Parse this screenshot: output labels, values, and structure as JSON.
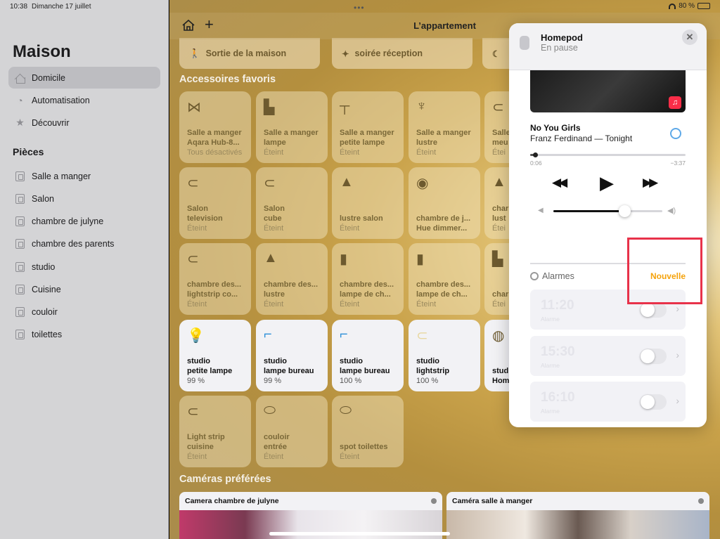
{
  "status": {
    "time": "10:38",
    "date": "Dimanche 17 juillet",
    "battery": "80 %",
    "battery_fraction": 0.8
  },
  "sidebar": {
    "title": "Maison",
    "nav": [
      {
        "label": "Domicile",
        "icon": "house-icon"
      },
      {
        "label": "Automatisation",
        "icon": "clock-icon"
      },
      {
        "label": "Découvrir",
        "icon": "star-icon"
      }
    ],
    "rooms_title": "Pièces",
    "rooms": [
      "Salle a manger",
      "Salon",
      "chambre de julyne",
      "chambre des parents",
      "studio",
      "Cuisine",
      "couloir",
      "toilettes"
    ]
  },
  "nav": {
    "title": "L’appartement",
    "add": "+"
  },
  "scenes": [
    {
      "label": "Sortie de la maison",
      "icon": "walking-person-icon"
    },
    {
      "label": "soirée réception",
      "icon": "party-popper-icon"
    },
    {
      "label": "",
      "icon": "moon-house-icon"
    }
  ],
  "favorites_title": "Accessoires favoris",
  "tiles": [
    {
      "l1": "Salle a manger",
      "l2": "Aqara Hub-8...",
      "st": "Tous désactivés",
      "icon": "hub-icon",
      "on": false
    },
    {
      "l1": "Salle a manger",
      "l2": "lampe",
      "st": "Éteint",
      "icon": "table-lamp-icon",
      "on": false
    },
    {
      "l1": "Salle a manger",
      "l2": "petite lampe",
      "st": "Éteint",
      "icon": "floor-lamp-icon",
      "on": false
    },
    {
      "l1": "Salle a manger",
      "l2": "lustre",
      "st": "Éteint",
      "icon": "chandelier-icon",
      "on": false
    },
    {
      "l1": "Salle",
      "l2": "meu",
      "st": "Étei",
      "icon": "lightstrip-icon",
      "on": false
    },
    {
      "l1": "Salon",
      "l2": "television",
      "st": "Éteint",
      "icon": "lightstrip-icon",
      "on": false
    },
    {
      "l1": "Salon",
      "l2": "cube",
      "st": "Éteint",
      "icon": "lightstrip-icon",
      "on": false
    },
    {
      "l1": "lustre salon",
      "l2": "",
      "st": "Éteint",
      "icon": "pendant-lamp-icon",
      "on": false
    },
    {
      "l1": "chambre de j...",
      "l2": "Hue dimmer...",
      "st": "",
      "icon": "dimmer-icon",
      "on": false
    },
    {
      "l1": "char",
      "l2": "lust",
      "st": "Étei",
      "icon": "pendant-lamp-icon",
      "on": false
    },
    {
      "l1": "chambre des...",
      "l2": "lightstrip co...",
      "st": "Éteint",
      "icon": "lightstrip-icon",
      "on": false
    },
    {
      "l1": "chambre des...",
      "l2": "lustre",
      "st": "Éteint",
      "icon": "pendant-lamp-icon",
      "on": false
    },
    {
      "l1": "chambre des...",
      "l2": "lampe de ch...",
      "st": "Éteint",
      "icon": "tube-lamp-icon",
      "on": false
    },
    {
      "l1": "chambre des...",
      "l2": "lampe de ch...",
      "st": "Éteint",
      "icon": "tube-lamp-icon",
      "on": false
    },
    {
      "l1": "char",
      "l2": "",
      "st": "Étei",
      "icon": "table-lamp-icon",
      "on": false
    },
    {
      "l1": "studio",
      "l2": "petite lampe",
      "st": "99 %",
      "icon": "bulb-icon",
      "on": true
    },
    {
      "l1": "studio",
      "l2": "lampe bureau",
      "st": "99 %",
      "icon": "desk-lamp-icon",
      "on": true
    },
    {
      "l1": "studio",
      "l2": "lampe bureau",
      "st": "100 %",
      "icon": "desk-lamp-icon",
      "on": true
    },
    {
      "l1": "studio",
      "l2": "lightstrip",
      "st": "100 %",
      "icon": "lightstrip-icon",
      "on": true
    },
    {
      "l1": "stud",
      "l2": "Hom",
      "st": "",
      "icon": "homepod-icon",
      "on": true
    },
    {
      "l1": "Light strip",
      "l2": "cuisine",
      "st": "Éteint",
      "icon": "lightstrip-icon",
      "on": false
    },
    {
      "l1": "couloir",
      "l2": "entrée",
      "st": "Éteint",
      "icon": "ceiling-light-icon",
      "on": false
    },
    {
      "l1": "spot toilettes",
      "l2": "",
      "st": "Éteint",
      "icon": "ceiling-light-icon",
      "on": false
    }
  ],
  "cameras_title": "Caméras préférées",
  "cameras": [
    {
      "label": "Camera chambre de julyne"
    },
    {
      "label": "Caméra salle à manger"
    }
  ],
  "popover": {
    "device": "Homepod",
    "state": "En pause",
    "close": "✕",
    "music_badge": "♫",
    "song": "No You Girls",
    "artist": "Franz Ferdinand — Tonight",
    "time_current": "0:06",
    "time_remaining": "−3:37",
    "progress": 0.03,
    "volume": 0.65,
    "rewind": "◀◀",
    "play": "▶",
    "forward": "▶▶",
    "alarms_label": "Alarmes",
    "new_alarm": "Nouvelle",
    "alarms": [
      {
        "time": "11:20",
        "label": "Alarme",
        "enabled": false
      },
      {
        "time": "15:30",
        "label": "Alarme",
        "enabled": false
      },
      {
        "time": "16:10",
        "label": "Alarme",
        "enabled": false
      }
    ]
  },
  "colors": {
    "accent": "#f5a20a",
    "highlight": "#e8324a",
    "tile_on": "#f2f2f5"
  }
}
